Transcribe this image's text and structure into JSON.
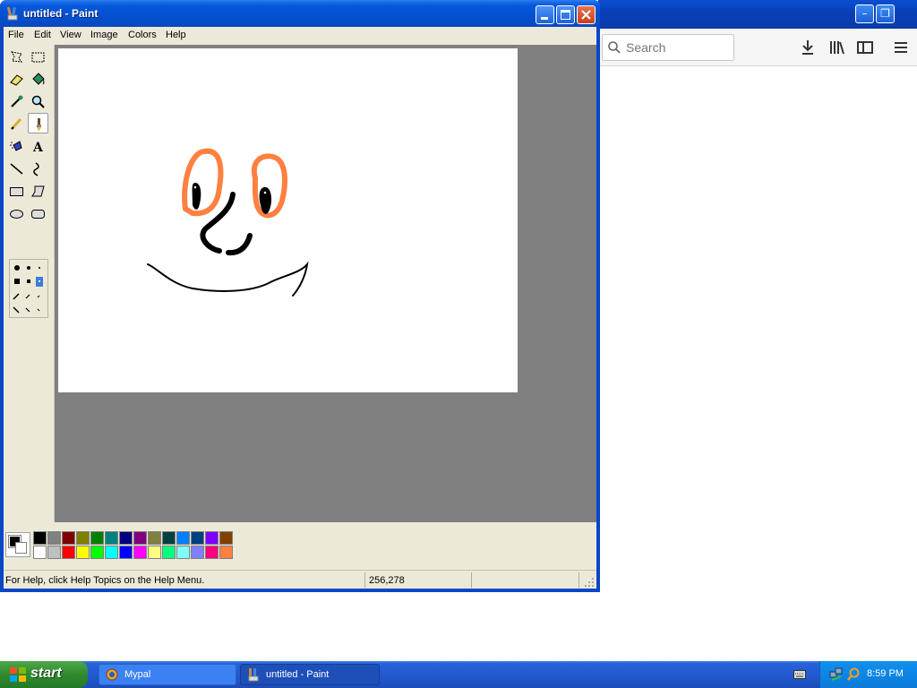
{
  "browser": {
    "search_placeholder": "Search",
    "minimize_glyph": "–",
    "restore_glyph": "❐",
    "toolbar_icons": [
      "download-icon",
      "library-icon",
      "sidebar-icon",
      "menu-icon"
    ]
  },
  "paint": {
    "title": "untitled - Paint",
    "menus": [
      "File",
      "Edit",
      "View",
      "Image",
      "Colors",
      "Help"
    ],
    "tools": [
      "free-form-select",
      "select",
      "eraser",
      "fill-with-color",
      "pick-color",
      "magnifier",
      "pencil",
      "brush",
      "airbrush",
      "text",
      "line",
      "curve",
      "rectangle",
      "polygon",
      "ellipse",
      "rounded-rectangle"
    ],
    "active_tool": "brush",
    "foreground_color": "#000000",
    "background_color": "#ffffff",
    "palette_top": [
      "#000000",
      "#808080",
      "#800000",
      "#808000",
      "#008000",
      "#008080",
      "#000080",
      "#800080",
      "#808040",
      "#004040",
      "#0080ff",
      "#004080",
      "#8000ff",
      "#804000"
    ],
    "palette_bottom": [
      "#ffffff",
      "#c0c0c0",
      "#ff0000",
      "#ffff00",
      "#00ff00",
      "#00ffff",
      "#0000ff",
      "#ff00ff",
      "#ffff80",
      "#00ff80",
      "#80ffff",
      "#8080ff",
      "#ff0080",
      "#ff8040"
    ],
    "status_text": "For Help, click Help Topics on the Help Menu.",
    "status_coords": "256,278"
  },
  "taskbar": {
    "start_label": "start",
    "items": [
      {
        "label": "Mypal",
        "active": false
      },
      {
        "label": "untitled - Paint",
        "active": true
      }
    ],
    "clock": "8:59 PM"
  }
}
